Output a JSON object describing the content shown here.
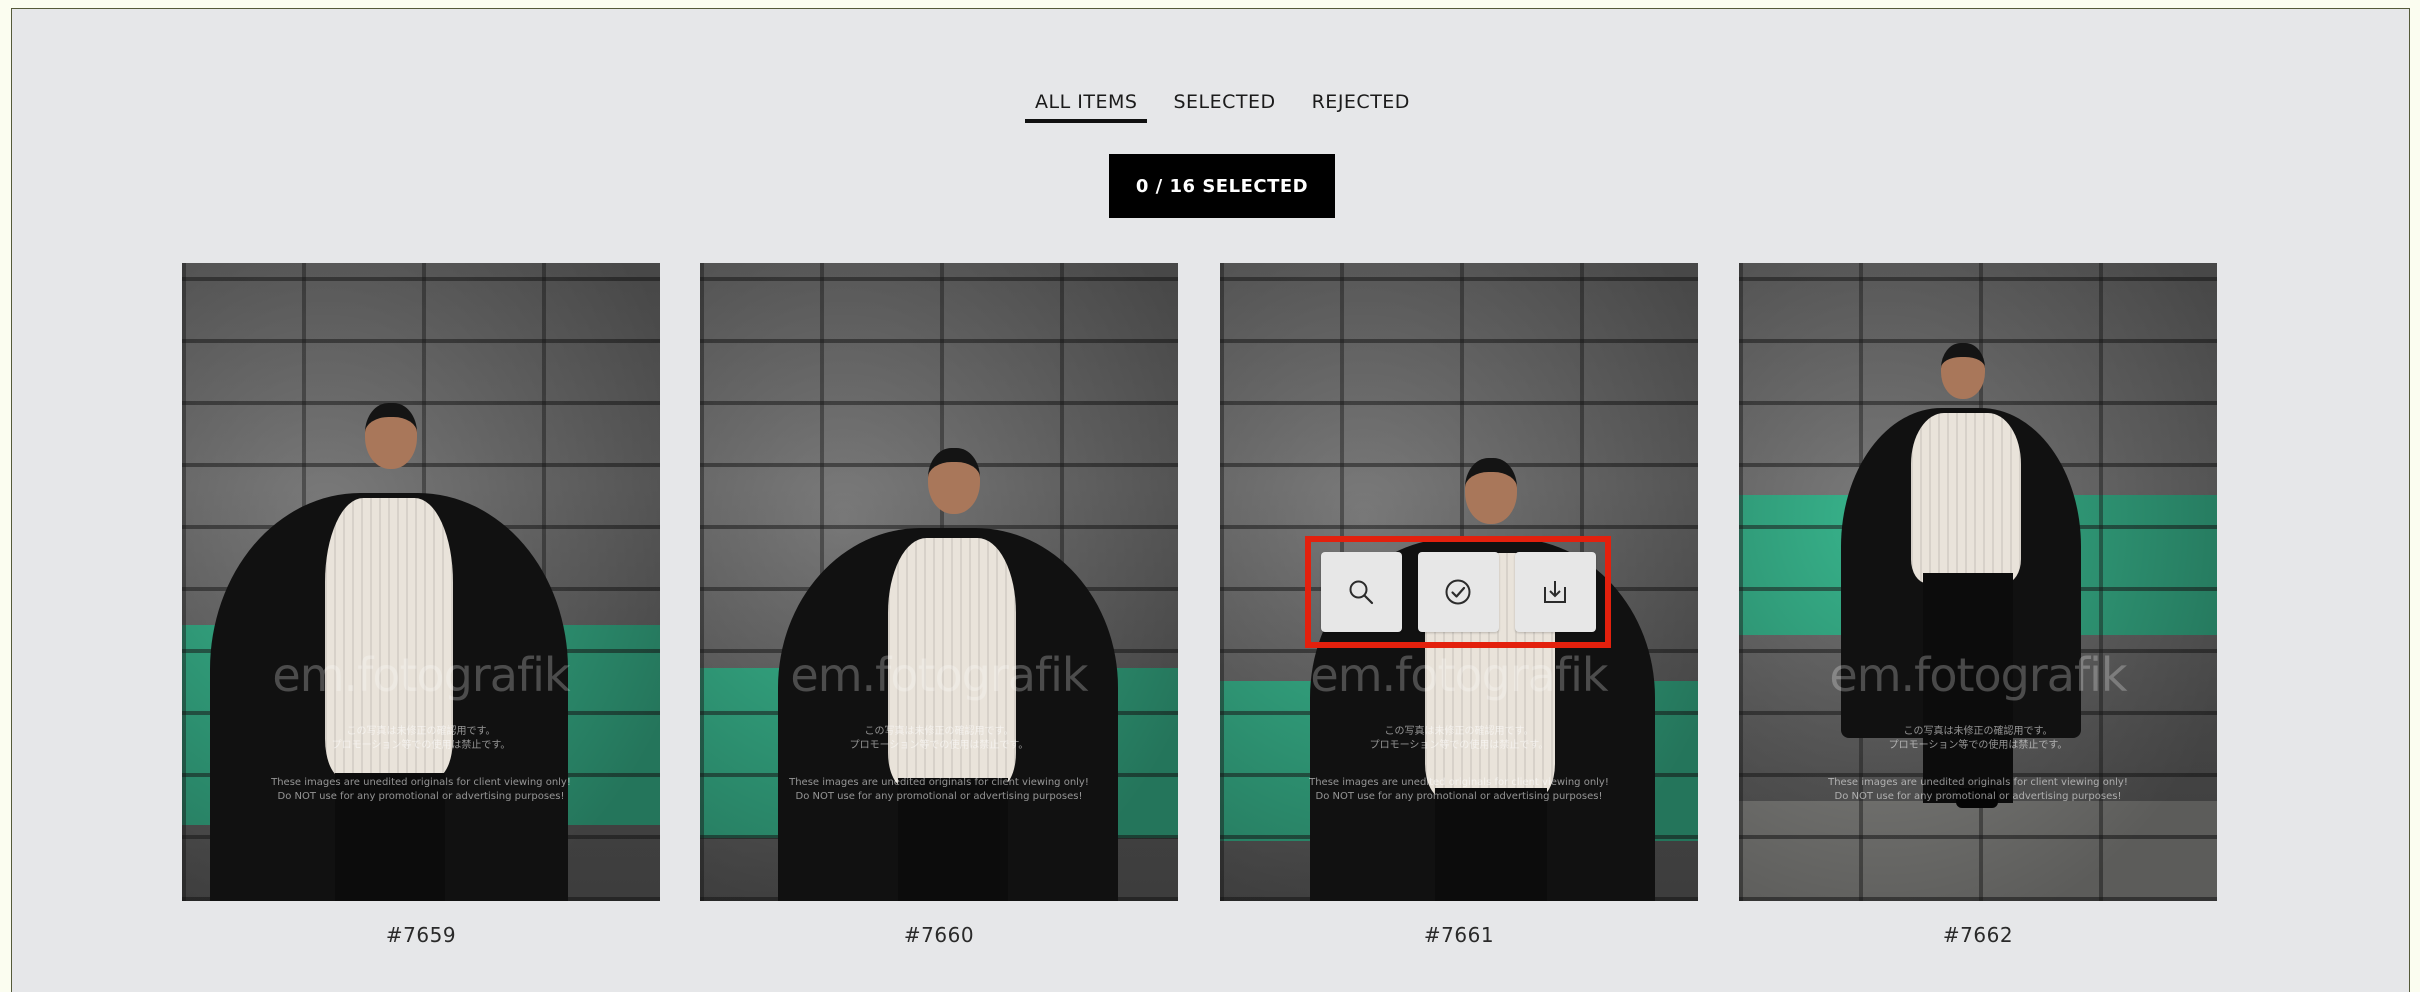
{
  "tabs": [
    {
      "label": "ALL ITEMS",
      "active": true
    },
    {
      "label": "SELECTED",
      "active": false
    },
    {
      "label": "REJECTED",
      "active": false
    }
  ],
  "selection_counter": "0 / 16 SELECTED",
  "photos": [
    {
      "label": "#7659"
    },
    {
      "label": "#7660"
    },
    {
      "label": "#7661",
      "hovered": true
    },
    {
      "label": "#7662"
    }
  ],
  "watermark": {
    "brand": "em.fotografik",
    "jp_line1": "この写真は未修正の確認用です。",
    "jp_line2": "プロモーション等での使用は禁止です。",
    "en_line1": "These images are unedited originals for client viewing only!",
    "en_line2": "Do NOT use for any promotional or advertising purposes!"
  },
  "hover_tools": [
    {
      "icon": "search-icon"
    },
    {
      "icon": "check-circle-icon"
    },
    {
      "icon": "download-icon"
    }
  ],
  "colors": {
    "page_bg": "#e6e7e9",
    "counter_bg": "#000000",
    "highlight_border": "#e3200d",
    "wall_stripe": "#38b48c"
  }
}
